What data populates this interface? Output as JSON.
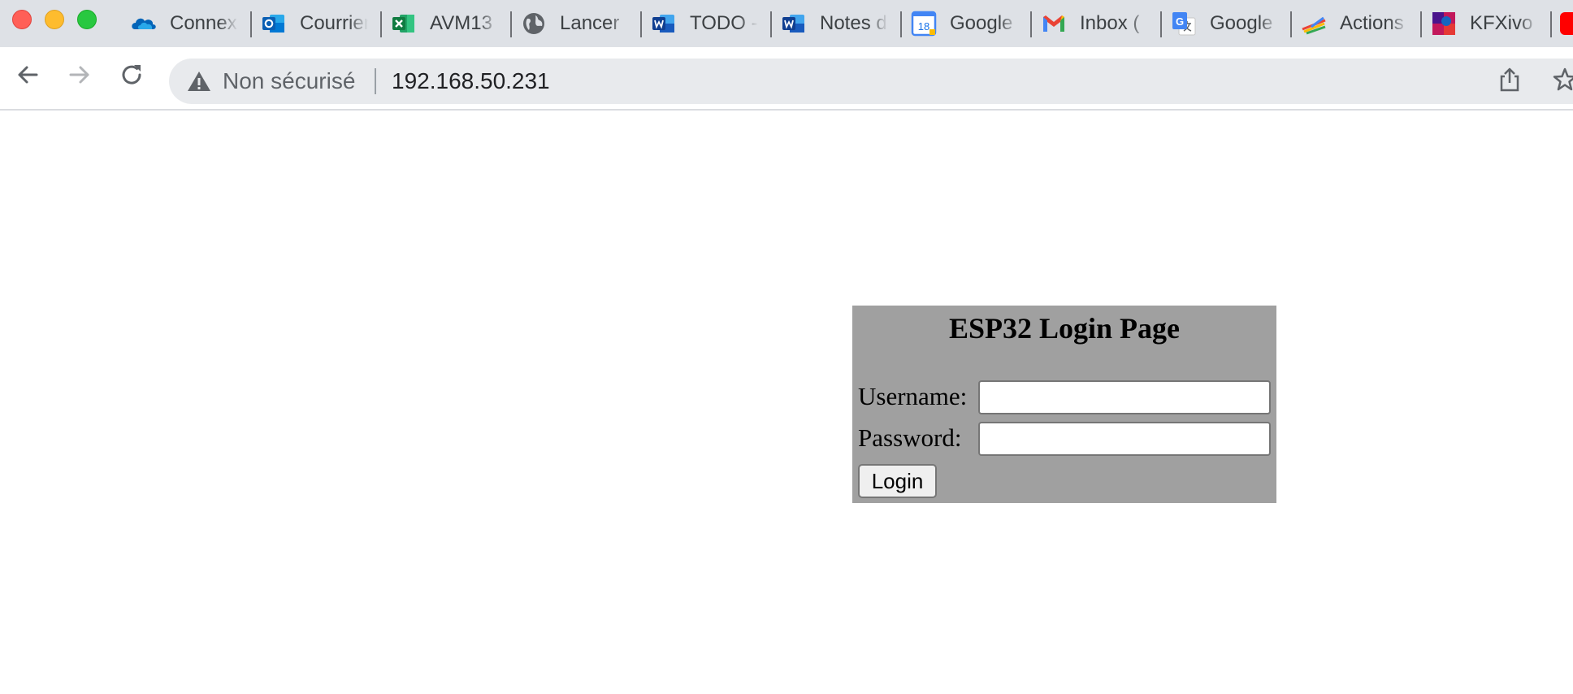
{
  "browser": {
    "window_controls": {
      "close": "close-window",
      "minimize": "minimize-window",
      "maximize": "maximize-window"
    },
    "tabs": [
      {
        "title": "Connexion",
        "icon": "onedrive-icon"
      },
      {
        "title": "Courrier",
        "icon": "outlook-icon"
      },
      {
        "title": "AVM13",
        "icon": "excel-icon"
      },
      {
        "title": "Lancer",
        "icon": "globe-icon"
      },
      {
        "title": "TODO -",
        "icon": "word-icon"
      },
      {
        "title": "Notes de",
        "icon": "word-icon"
      },
      {
        "title": "Google",
        "icon": "google-calendar-icon",
        "badge": "18"
      },
      {
        "title": "Inbox (",
        "icon": "gmail-icon"
      },
      {
        "title": "Google",
        "icon": "google-translate-icon"
      },
      {
        "title": "Actions",
        "icon": "actions-icon"
      },
      {
        "title": "KFXivo",
        "icon": "kfxivo-icon"
      }
    ],
    "address_bar": {
      "security_label": "Non sécurisé",
      "url": "192.168.50.231"
    },
    "colors": {
      "tabstrip": "#dee1e6",
      "omnibox": "#e8eaed"
    }
  },
  "page": {
    "title": "ESP32 Login Page",
    "username_label": "Username:",
    "username_value": "",
    "password_label": "Password:",
    "password_value": "",
    "login_button": "Login",
    "colors": {
      "panel_background": "#a0a0a0",
      "page_background": "#ffffff"
    }
  }
}
